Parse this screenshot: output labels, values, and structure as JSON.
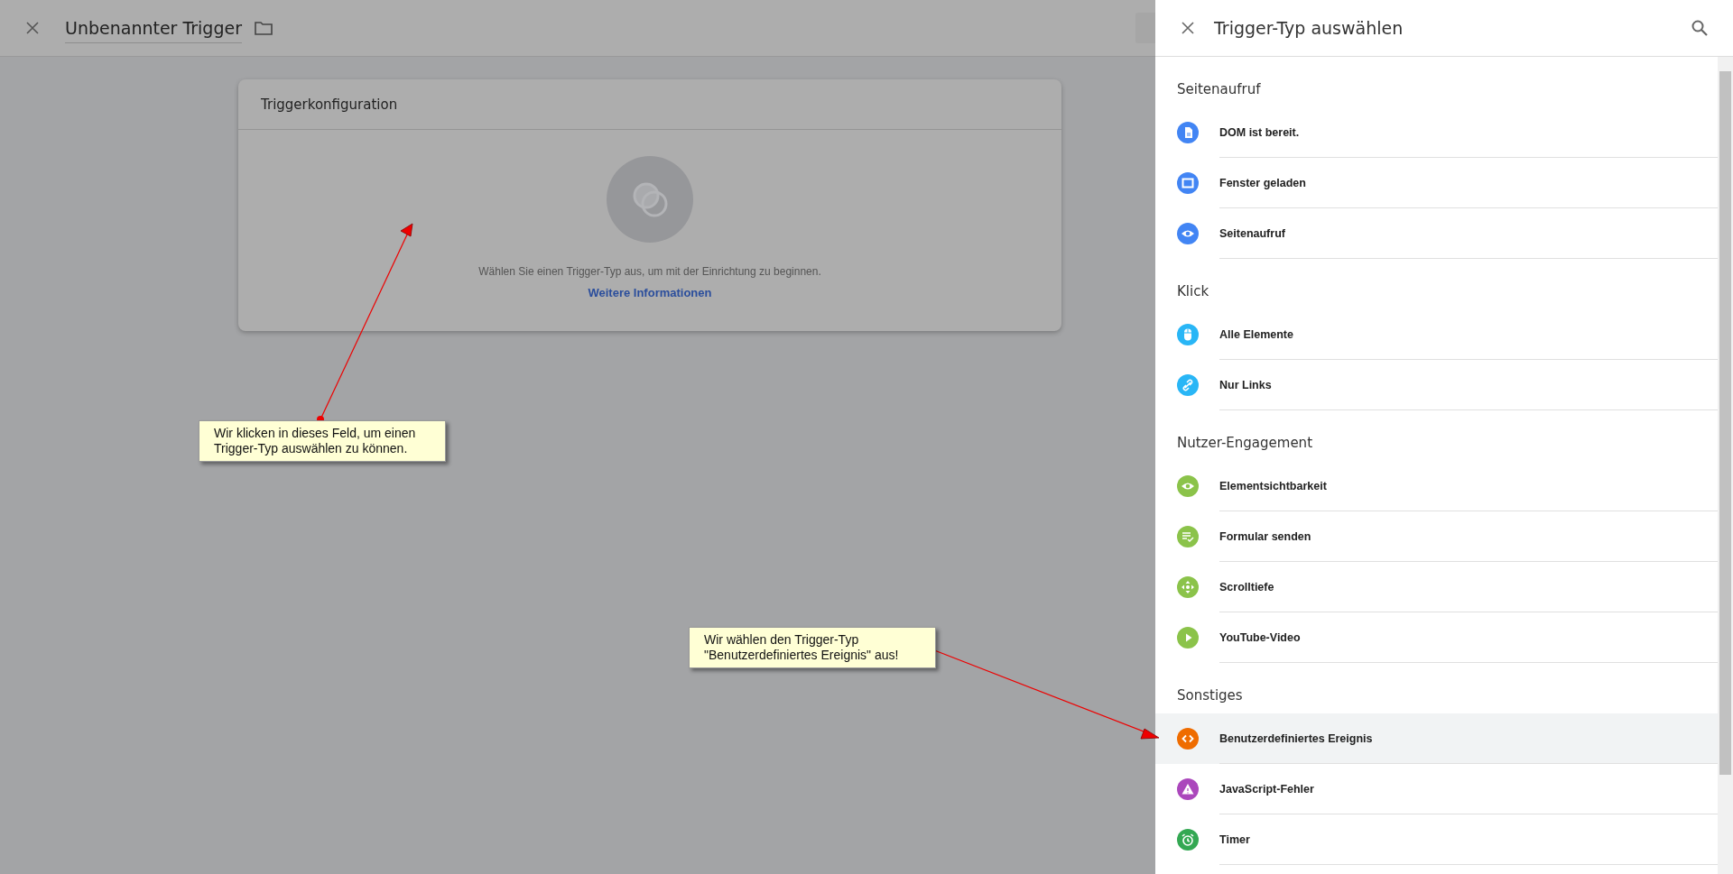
{
  "editor": {
    "title": "Unbenannter Trigger",
    "card": {
      "title": "Triggerkonfiguration",
      "hint": "Wählen Sie einen Trigger-Typ aus, um mit der Einrichtung zu beginnen.",
      "link": "Weitere Informationen"
    }
  },
  "panel": {
    "title": "Trigger-Typ auswählen",
    "sections": [
      {
        "heading": "Seitenaufruf",
        "items": [
          {
            "label": "DOM ist bereit.",
            "kind": "document",
            "color": "#4285f4",
            "selected": false
          },
          {
            "label": "Fenster geladen",
            "kind": "window",
            "color": "#4285f4",
            "selected": false
          },
          {
            "label": "Seitenaufruf",
            "kind": "eye",
            "color": "#4285f4",
            "selected": false
          }
        ]
      },
      {
        "heading": "Klick",
        "items": [
          {
            "label": "Alle Elemente",
            "kind": "mouse",
            "color": "#29b6f6",
            "selected": false
          },
          {
            "label": "Nur Links",
            "kind": "link",
            "color": "#29b6f6",
            "selected": false
          }
        ]
      },
      {
        "heading": "Nutzer-Engagement",
        "items": [
          {
            "label": "Elementsichtbarkeit",
            "kind": "eye",
            "color": "#8bc34a",
            "selected": false
          },
          {
            "label": "Formular senden",
            "kind": "form",
            "color": "#8bc34a",
            "selected": false
          },
          {
            "label": "Scrolltiefe",
            "kind": "move",
            "color": "#8bc34a",
            "selected": false
          },
          {
            "label": "YouTube-Video",
            "kind": "play",
            "color": "#8bc34a",
            "selected": false
          }
        ]
      },
      {
        "heading": "Sonstiges",
        "items": [
          {
            "label": "Benutzerdefiniertes Ereignis",
            "kind": "code",
            "color": "#ef6c00",
            "selected": true
          },
          {
            "label": "JavaScript-Fehler",
            "kind": "warning",
            "color": "#ab47bc",
            "selected": false
          },
          {
            "label": "Timer",
            "kind": "alarm",
            "color": "#34a853",
            "selected": false
          }
        ]
      }
    ]
  },
  "annotations": [
    {
      "text": "Wir klicken in dieses Feld, um einen\nTrigger-Typ auswählen zu können."
    },
    {
      "text": "Wir wählen den Trigger-Typ\n\"Benutzerdefiniertes Ereignis\" aus!"
    }
  ]
}
